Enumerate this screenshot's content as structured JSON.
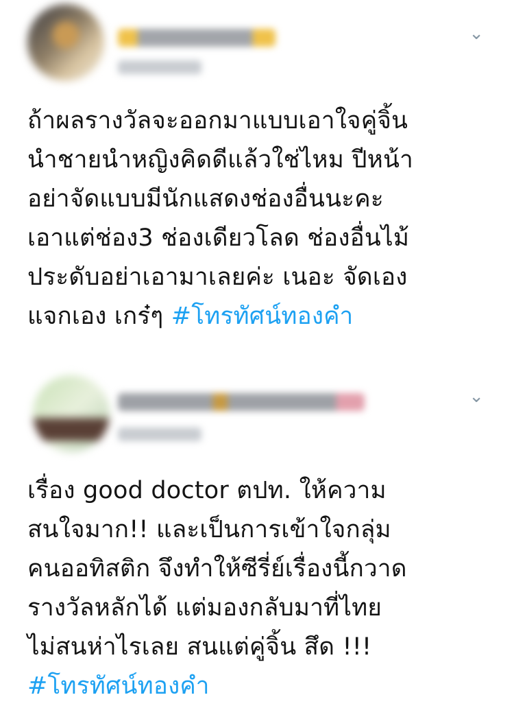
{
  "tweets": [
    {
      "display_name": "",
      "handle": "",
      "menu_icon": "chevron-down-icon",
      "lines": [
        "ถ้าผลรางวัลจะออกมาแบบเอาใจคู่จิ้น",
        "นำชายนำหญิงคิดดีแล้วใช่ไหม ปีหน้า",
        "อย่าจัดแบบมีนักแสดงช่องอื่นนะคะ",
        "เอาแต่ช่อง3 ช่องเดียวโลด ช่องอื่นไม้",
        "ประดับอย่าเอามาเลยค่ะ เนอะ จัดเอง"
      ],
      "last_line_text": "แจกเอง เกร๋ๆ ",
      "hashtag": "#โทรทัศน์ทองคำ"
    },
    {
      "display_name": "",
      "handle": "",
      "menu_icon": "chevron-down-icon",
      "lines": [
        "เรื่อง good doctor ตปท. ให้ความ",
        "สนใจมาก!! และเป็นการเข้าใจกลุ่ม",
        "คนออทิสติก จึงทำให้ซีรี่ย์เรื่องนี้กวาด",
        "รางวัลหลักได้ แต่มองกลับมาที่ไทย",
        "ไม่สนห่าไรเลย สนแต่คู่จิ้น สึด !!!"
      ],
      "hashtag": "#โทรทัศน์ทองคำ"
    }
  ],
  "colors": {
    "text": "#141414",
    "hashtag": "#1da1f2",
    "icon": "#8899a6"
  }
}
